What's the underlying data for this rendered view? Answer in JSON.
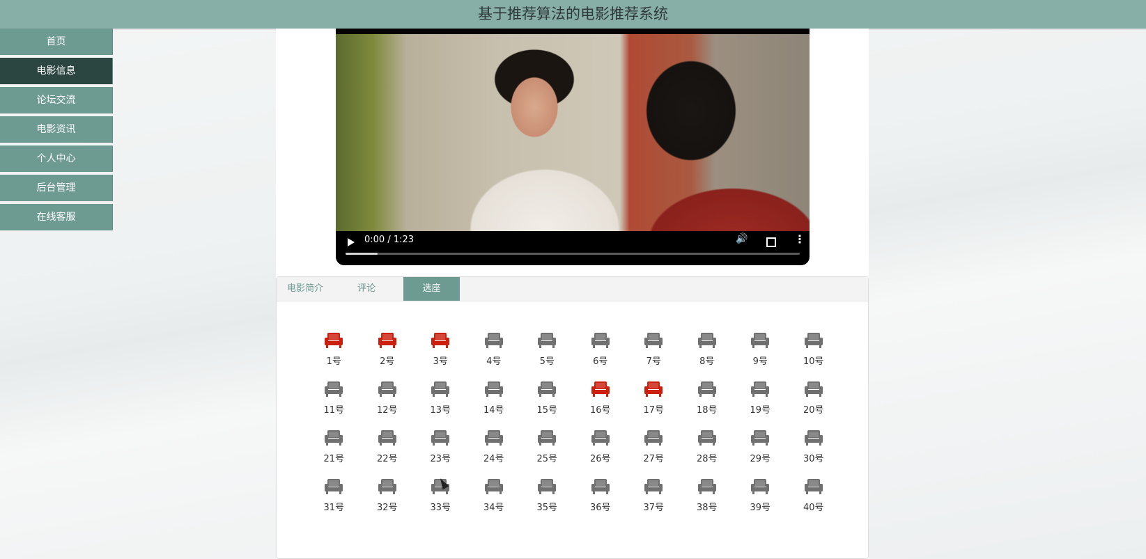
{
  "app": {
    "title": "基于推荐算法的电影推荐系统"
  },
  "sidebar": {
    "items": [
      {
        "label": "首页",
        "active": false
      },
      {
        "label": "电影信息",
        "active": true
      },
      {
        "label": "论坛交流",
        "active": false
      },
      {
        "label": "电影资讯",
        "active": false
      },
      {
        "label": "个人中心",
        "active": false
      },
      {
        "label": "后台管理",
        "active": false
      },
      {
        "label": "在线客服",
        "active": false
      }
    ]
  },
  "video": {
    "time": "0:00 / 1:23",
    "progress": 0.07,
    "icons": [
      "play-icon",
      "volume-icon",
      "fullscreen-icon",
      "more-options-icon"
    ]
  },
  "tabs": {
    "items": [
      {
        "label": "电影简介",
        "active": false
      },
      {
        "label": "评论",
        "active": false
      },
      {
        "label": "选座",
        "active": true
      }
    ]
  },
  "seats": {
    "colors": {
      "taken": "#cc1f0e",
      "available": "#707070"
    },
    "taken": [
      1,
      2,
      3,
      16,
      17
    ],
    "items": [
      "1号",
      "2号",
      "3号",
      "4号",
      "5号",
      "6号",
      "7号",
      "8号",
      "9号",
      "10号",
      "11号",
      "12号",
      "13号",
      "14号",
      "15号",
      "16号",
      "17号",
      "18号",
      "19号",
      "20号",
      "21号",
      "22号",
      "23号",
      "24号",
      "25号",
      "26号",
      "27号",
      "28号",
      "29号",
      "30号",
      "31号",
      "32号",
      "33号",
      "34号",
      "35号",
      "36号",
      "37号",
      "38号",
      "39号",
      "40号"
    ]
  }
}
